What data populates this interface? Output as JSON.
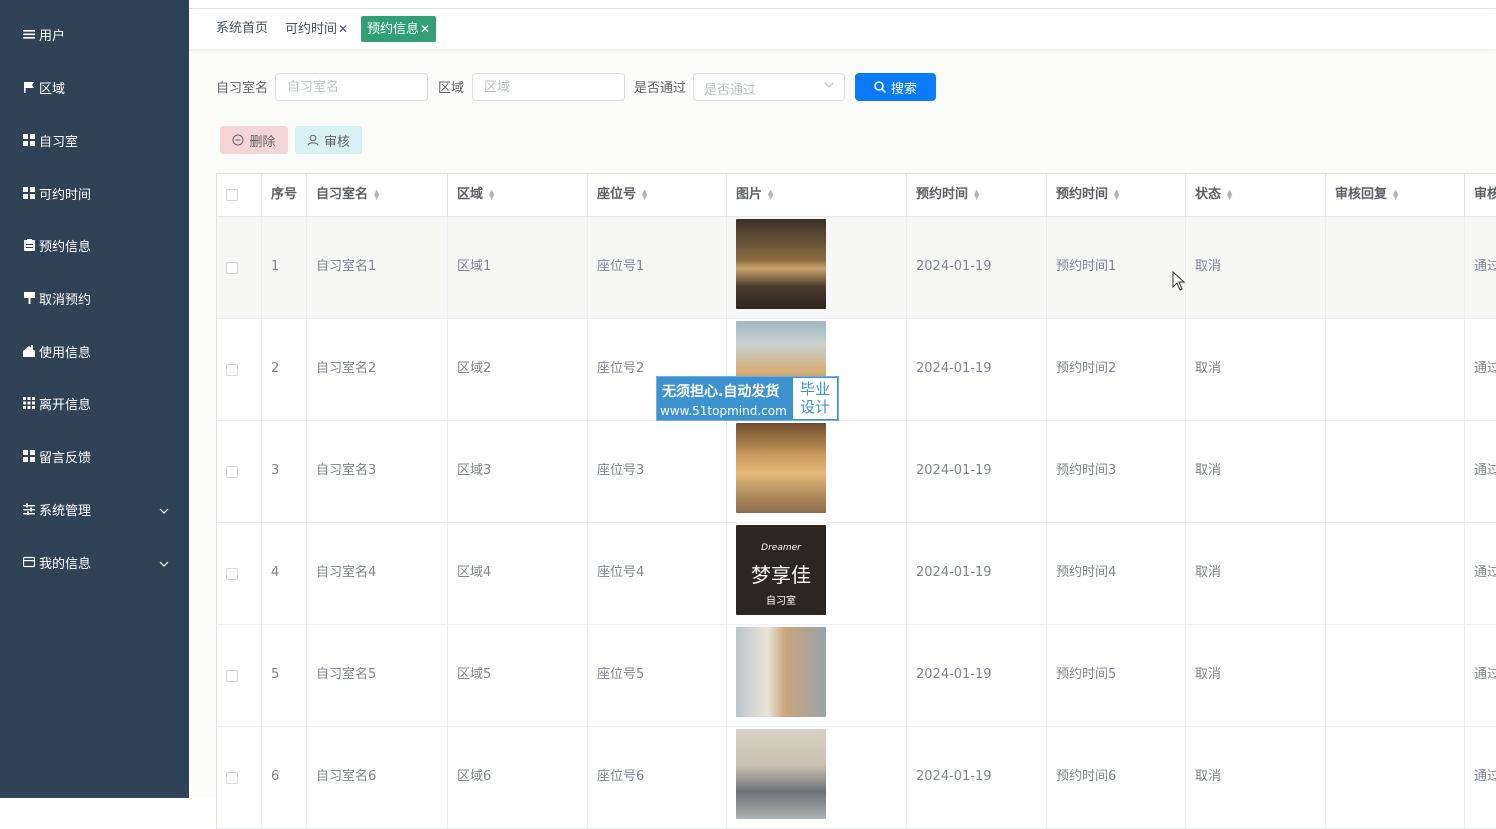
{
  "sidebar": {
    "items": [
      {
        "label": "用户",
        "icon": "list-icon"
      },
      {
        "label": "区域",
        "icon": "flag-icon"
      },
      {
        "label": "自习室",
        "icon": "grid-icon"
      },
      {
        "label": "可约时间",
        "icon": "grid-icon"
      },
      {
        "label": "预约信息",
        "icon": "clipboard-icon"
      },
      {
        "label": "取消预约",
        "icon": "sign-icon"
      },
      {
        "label": "使用信息",
        "icon": "home-icon"
      },
      {
        "label": "离开信息",
        "icon": "grid9-icon"
      },
      {
        "label": "留言反馈",
        "icon": "grid-icon"
      },
      {
        "label": "系统管理",
        "icon": "sliders-icon",
        "has_submenu": true
      },
      {
        "label": "我的信息",
        "icon": "card-icon",
        "has_submenu": true
      }
    ]
  },
  "tabs": [
    {
      "label": "系统首页"
    },
    {
      "label": "可约时间",
      "closable": true
    },
    {
      "label": "预约信息",
      "closable": true,
      "active": true
    }
  ],
  "search": {
    "room_label": "自习室名",
    "room_placeholder": "自习室名",
    "area_label": "区域",
    "area_placeholder": "区域",
    "pass_label": "是否通过",
    "pass_placeholder": "是否通过",
    "search_button": "搜索"
  },
  "actions": {
    "delete": "删除",
    "audit": "审核"
  },
  "colors": {
    "sidebar_bg": "#2f4256",
    "active_tab": "#31a076",
    "primary": "#0a7cfb"
  },
  "table": {
    "headers": [
      "序号",
      "自习室名",
      "区域",
      "座位号",
      "图片",
      "预约时间",
      "预约时间",
      "状态",
      "审核回复",
      "审核"
    ],
    "rows": [
      {
        "index": "1",
        "room": "自习室名1",
        "area": "区域1",
        "seat": "座位号1",
        "date": "2024-01-19",
        "time": "预约时间1",
        "status": "取消",
        "reply": "",
        "audit": "通过"
      },
      {
        "index": "2",
        "room": "自习室名2",
        "area": "区域2",
        "seat": "座位号2",
        "date": "2024-01-19",
        "time": "预约时间2",
        "status": "取消",
        "reply": "",
        "audit": "通过"
      },
      {
        "index": "3",
        "room": "自习室名3",
        "area": "区域3",
        "seat": "座位号3",
        "date": "2024-01-19",
        "time": "预约时间3",
        "status": "取消",
        "reply": "",
        "audit": "通过"
      },
      {
        "index": "4",
        "room": "自习室名4",
        "area": "区域4",
        "seat": "座位号4",
        "date": "2024-01-19",
        "time": "预约时间4",
        "status": "取消",
        "reply": "",
        "audit": "通过",
        "logo_text": "梦享佳",
        "logo_sub": "自习室",
        "logo_brand": "Dreamer"
      },
      {
        "index": "5",
        "room": "自习室名5",
        "area": "区域5",
        "seat": "座位号5",
        "date": "2024-01-19",
        "time": "预约时间5",
        "status": "取消",
        "reply": "",
        "audit": "通过"
      },
      {
        "index": "6",
        "room": "自习室名6",
        "area": "区域6",
        "seat": "座位号6",
        "date": "2024-01-19",
        "time": "预约时间6",
        "status": "取消",
        "reply": "",
        "audit": "通过"
      }
    ]
  },
  "watermark": {
    "line1": "无须担心.自动发货",
    "line2": "www.51topmind.com",
    "badge1": "毕业",
    "badge2": "设计"
  }
}
